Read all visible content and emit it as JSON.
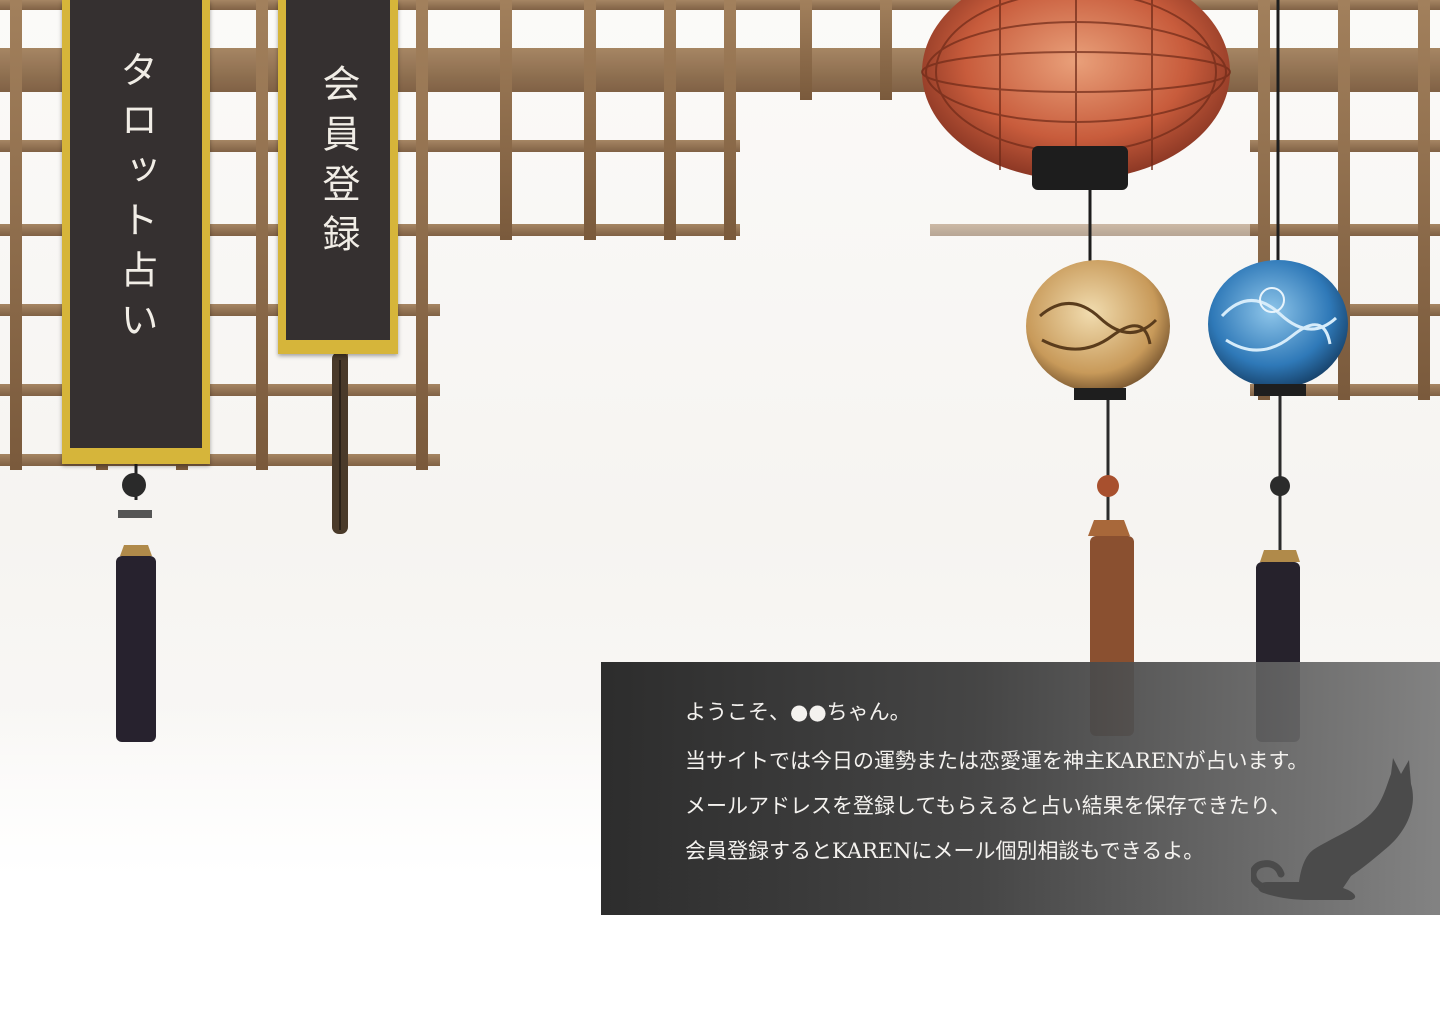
{
  "navigation": {
    "tarot_label": "タロット占い",
    "member_label": "会員登録"
  },
  "welcome": {
    "line1": "ようこそ、●●ちゃん。",
    "line2": "当サイトでは今日の運勢または恋愛運を神主KARENが占います。",
    "line3": "メールアドレスを登録してもらえると占い結果を保存できたり、",
    "line4": "会員登録するとKARENにメール個別相談もできるよ。"
  },
  "colors": {
    "banner_gold": "#d6b53a",
    "banner_dark": "#353030",
    "panel_dark": "#262626",
    "lattice_wood": "#8b6a48"
  },
  "icons": {
    "cat": "stretching-cat-icon"
  }
}
